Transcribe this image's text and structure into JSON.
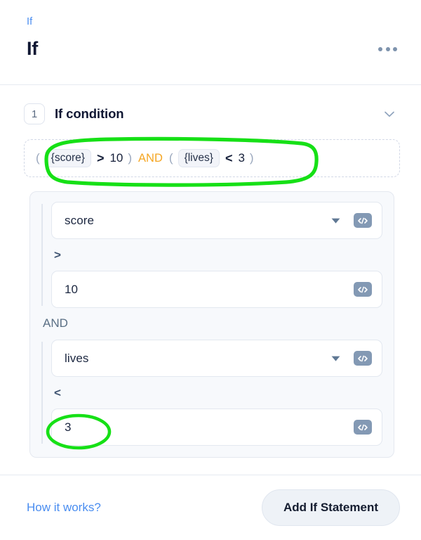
{
  "header": {
    "breadcrumb": "If",
    "title": "If",
    "menu_icon": "kebab-menu-icon"
  },
  "section": {
    "step_number": "1",
    "title": "If condition",
    "collapse_icon": "chevron-down-icon"
  },
  "expression": {
    "open_paren_1": "(",
    "var_1": "{score}",
    "operator_1": ">",
    "value_1": "10",
    "close_paren_1": ")",
    "logic": "AND",
    "open_paren_2": "(",
    "var_2": "{lives}",
    "operator_2": "<",
    "value_2": "3",
    "close_paren_2": ")"
  },
  "builder": {
    "logic_separator": "AND",
    "conditions": [
      {
        "field_value": "score",
        "field_has_dropdown": true,
        "operator": ">",
        "compare_value": "10",
        "dropdown_icon": "caret-down-icon",
        "code_icon": "code-brackets-icon"
      },
      {
        "field_value": "lives",
        "field_has_dropdown": true,
        "operator": "<",
        "compare_value": "3",
        "dropdown_icon": "caret-down-icon",
        "code_icon": "code-brackets-icon"
      }
    ]
  },
  "footer": {
    "help_link": "How it works?",
    "primary_button": "Add If Statement"
  },
  "colors": {
    "link_blue": "#4a8df0",
    "logic_orange": "#f5a623",
    "annotation_green": "#16e016",
    "code_button": "#8399b4",
    "title_navy": "#101733"
  },
  "annotations": [
    {
      "name": "highlight-expression",
      "shape": "rounded-rectangle",
      "color": "#16e016"
    },
    {
      "name": "highlight-value-3",
      "shape": "ellipse",
      "color": "#16e016"
    }
  ]
}
